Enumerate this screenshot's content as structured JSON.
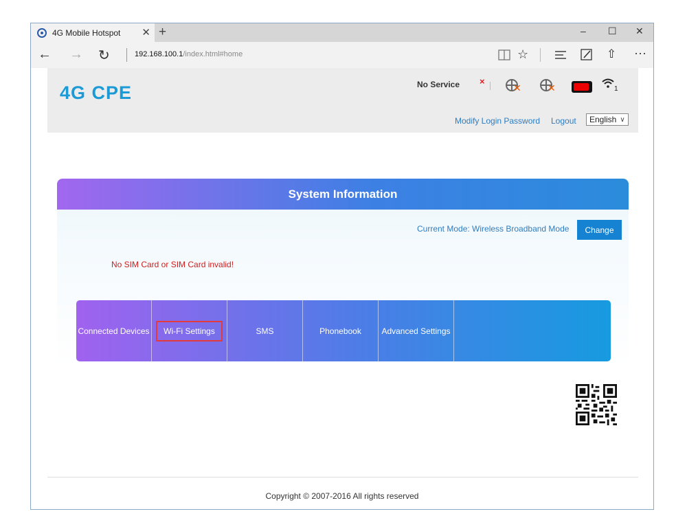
{
  "browser": {
    "tab_title": "4G Mobile Hotspot",
    "tab_close": "✕",
    "new_tab": "+",
    "window_controls": {
      "minimize": "–",
      "maximize": "☐",
      "close": "✕"
    },
    "url_host": "192.168.100.1",
    "url_path": "/index.html#home",
    "nav": {
      "back": "←",
      "forward": "→",
      "refresh": "↻"
    },
    "toolbar_icons": [
      "reading-view-icon",
      "favorite-star-icon",
      "hub-icon",
      "web-note-icon",
      "share-icon",
      "more-icon"
    ]
  },
  "header": {
    "logo": "4G CPE",
    "service_status": "No Service",
    "sim_status_x": "×",
    "wifi_clients": "1",
    "links": {
      "modify_password": "Modify Login Password",
      "logout": "Logout"
    },
    "language": "English"
  },
  "panel": {
    "title": "System Information",
    "current_mode": "Current Mode: Wireless Broadband Mode",
    "change_label": "Change",
    "sim_message": "No SIM Card or SIM Card invalid!",
    "menu": [
      {
        "label": "Connected Devices"
      },
      {
        "label": "Wi-Fi Settings",
        "selected": true
      },
      {
        "label": "SMS"
      },
      {
        "label": "Phonebook"
      },
      {
        "label": "Advanced Settings"
      }
    ]
  },
  "footer": {
    "copyright": "Copyright © 2007-2016 All rights reserved"
  },
  "colors": {
    "brand": "#1b9ad6",
    "link": "#2e7cbf",
    "button": "#1683d2",
    "error": "#cc1e1e"
  }
}
